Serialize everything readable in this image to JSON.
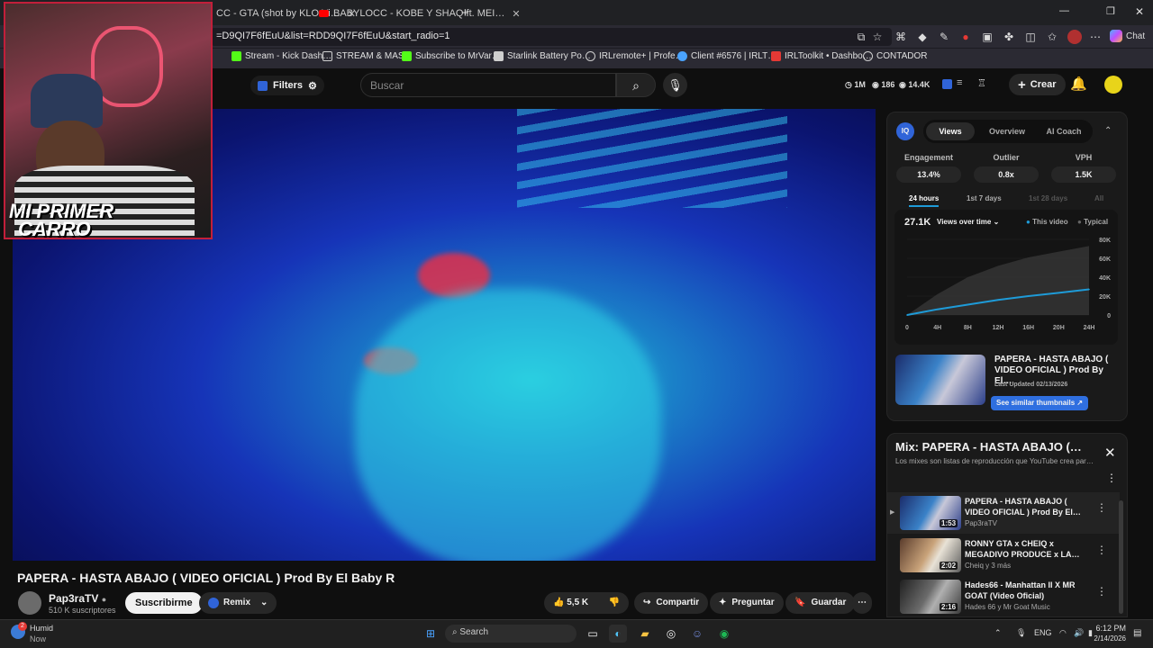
{
  "browser": {
    "tabs": [
      {
        "label": "CC - GTA (shot by KLO Vi…"
      },
      {
        "label": "BABYLOCC - KOBE Y SHAQ ft. MEI…"
      }
    ],
    "new_tab": "+",
    "url": "=D9QI7F6fEuU&list=RDD9QI7F6fEuU&start_radio=1",
    "bookmarks": [
      {
        "label": "Stream - Kick Dash…",
        "color": "#53fc18"
      },
      {
        "label": "STREAM & MAS",
        "color": "#cfcfcf"
      },
      {
        "label": "Subscribe to MrVar…",
        "color": "#53fc18"
      },
      {
        "label": "Starlink Battery Po…",
        "color": "#cfcfcf"
      },
      {
        "label": "IRLremote+ | Profe…",
        "color": "#cfcfcf"
      },
      {
        "label": "Client #6576 | IRLT…",
        "color": "#4aa3ff"
      },
      {
        "label": "IRLToolkit • Dashbo…",
        "color": "#e53935"
      },
      {
        "label": "CONTADOR",
        "color": "#cfcfcf"
      }
    ],
    "chat_label": "Chat"
  },
  "youtube": {
    "filters_label": "Filters",
    "search_placeholder": "Buscar",
    "stats": [
      {
        "icon": "clock-icon",
        "value": "1M"
      },
      {
        "icon": "eye-icon",
        "value": "186"
      },
      {
        "icon": "eye-icon",
        "value": "14.4K"
      }
    ],
    "create_label": "Crear"
  },
  "webcam": {
    "overlay_line1": "MI PRIMER",
    "overlay_line2": "CARRO"
  },
  "video": {
    "title": "PAPERA - HASTA ABAJO ( VIDEO OFICIAL ) Prod By El Baby R",
    "channel": "Pap3raTV",
    "subscribers": "510 K suscriptores",
    "subscribe_label": "Suscribirme",
    "remix_label": "Remix",
    "likes": "5,5 K",
    "share_label": "Compartir",
    "ask_label": "Preguntar",
    "save_label": "Guardar"
  },
  "iq_panel": {
    "logo": "IQ",
    "tabs": [
      "Views",
      "Overview",
      "AI Coach"
    ],
    "active_tab": "Views",
    "metrics": [
      {
        "label": "Engagement",
        "value": "13.4%"
      },
      {
        "label": "Outlier",
        "value": "0.8x"
      },
      {
        "label": "VPH",
        "value": "1.5K"
      }
    ],
    "ranges": [
      "24 hours",
      "1st 7 days",
      "1st 28 days",
      "All"
    ],
    "active_range": "24 hours",
    "total_views": "27.1K",
    "views_dropdown": "Views over time",
    "legend_this": "This video",
    "legend_typical": "Typical",
    "card_title": "PAPERA - HASTA ABAJO ( VIDEO OFICIAL ) Prod By El…",
    "card_updated": "Last Updated 02/13/2026",
    "similar_label": "See similar thumbnails ↗",
    "colors": {
      "this_video": "#1e9bd8",
      "typical": "#555555",
      "accent": "#3064d8"
    }
  },
  "chart_data": {
    "type": "area",
    "x": [
      "0",
      "4H",
      "8H",
      "12H",
      "16H",
      "20H",
      "24H"
    ],
    "ylim": [
      0,
      80000
    ],
    "yticks": [
      "80K",
      "60K",
      "40K",
      "20K",
      "0"
    ],
    "series": [
      {
        "name": "This video",
        "values": [
          0,
          6000,
          11000,
          16000,
          20000,
          23500,
          27100
        ]
      },
      {
        "name": "Typical",
        "values": [
          0,
          22000,
          40000,
          52000,
          61000,
          67000,
          73000
        ]
      }
    ]
  },
  "mix": {
    "title": "Mix: PAPERA - HASTA ABAJO (…",
    "description": "Los mixes son listas de reproducción que YouTube crea par…",
    "items": [
      {
        "title": "PAPERA - HASTA ABAJO ( VIDEO OFICIAL ) Prod By El…",
        "channel": "Pap3raTV",
        "duration": "1:53",
        "thumb": "linear-gradient(120deg,#1b2c6b,#3a82c8 45%,#c8c8d8 60%,#2c3f8a)"
      },
      {
        "title": "RONNY GTA x CHEIQ x MEGADIVO PRODUCE x LA…",
        "channel": "Cheiq y 3 más",
        "duration": "2:02",
        "thumb": "linear-gradient(120deg,#5a3c2c,#c9a37a 45%,#e8e2d6 60%,#5b5b5b)"
      },
      {
        "title": "Hades66 - Manhattan II X MR GOAT (Video Oficial)",
        "channel": "Hades 66 y Mr Goat Music",
        "duration": "2:16",
        "thumb": "linear-gradient(120deg,#202020,#6b6b6b 45%,#b0b0b0 60%,#3b3b3b)"
      }
    ]
  },
  "taskbar": {
    "weather_title": "Humid",
    "weather_sub": "Now",
    "weather_badge": "2",
    "search_placeholder": "Search",
    "lang": "ENG",
    "time": "6:12 PM",
    "date": "2/14/2026"
  }
}
